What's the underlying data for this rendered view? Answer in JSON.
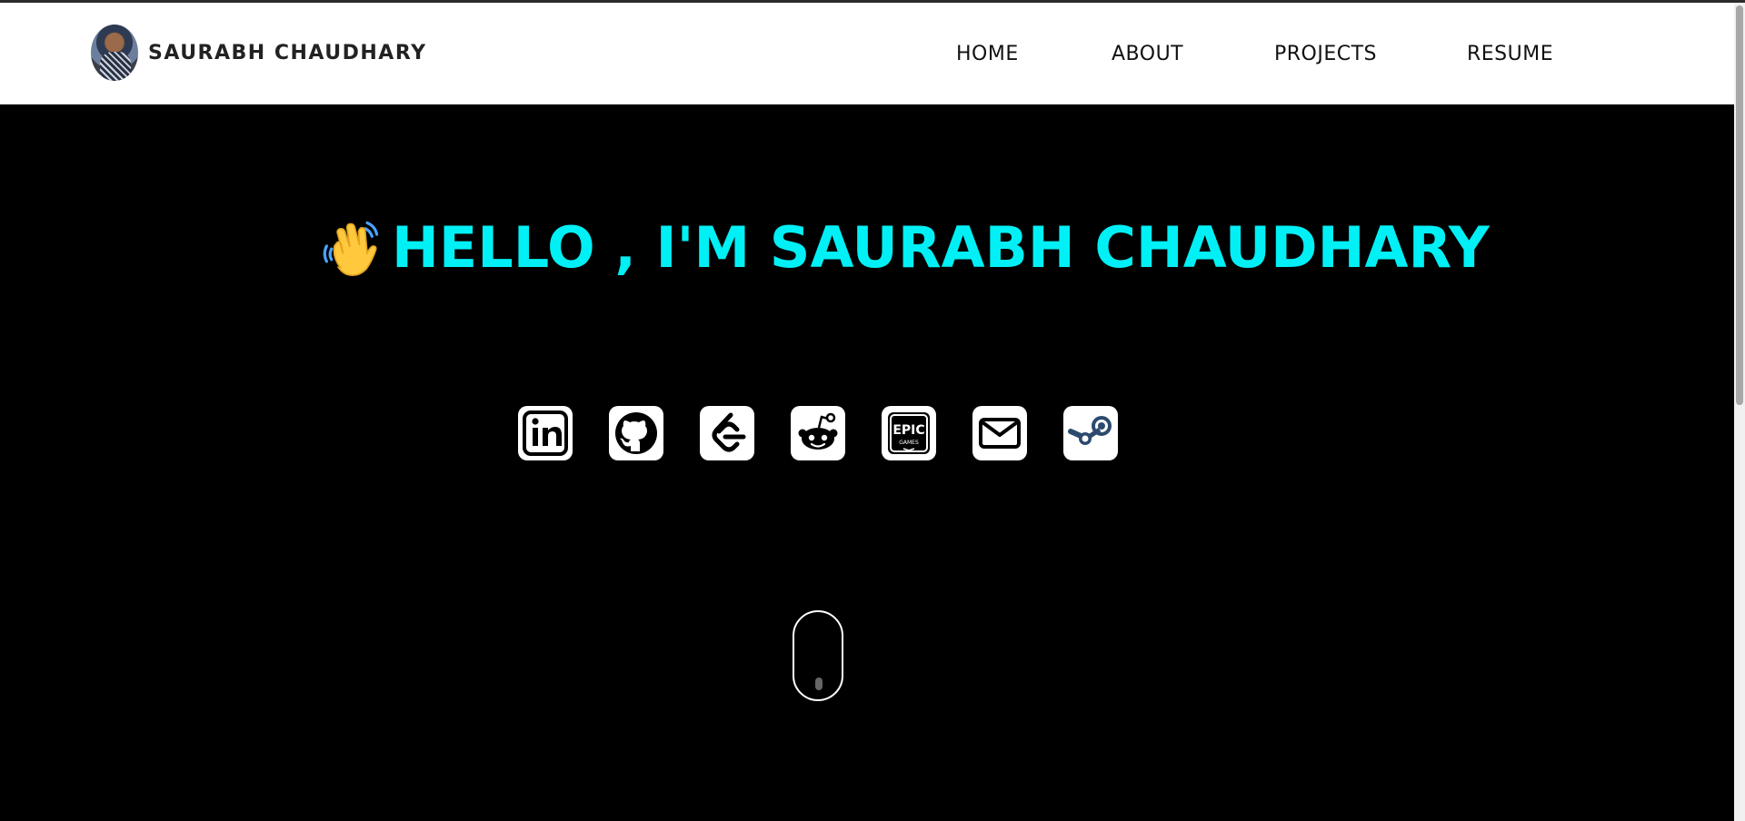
{
  "header": {
    "brand_name": "SAURABH CHAUDHARY",
    "nav": [
      {
        "label": "HOME"
      },
      {
        "label": "ABOUT"
      },
      {
        "label": "PROJECTS"
      },
      {
        "label": "RESUME"
      }
    ]
  },
  "hero": {
    "title": "HELLO , I'M SAURABH CHAUDHARY",
    "wave_icon": "waving-hand-icon",
    "title_color": "#00f0f5"
  },
  "socials": [
    {
      "name": "linkedin-icon"
    },
    {
      "name": "github-icon"
    },
    {
      "name": "leetcode-icon"
    },
    {
      "name": "reddit-icon"
    },
    {
      "name": "epic-games-icon",
      "text_line1": "EPIC",
      "text_line2": "GAMES"
    },
    {
      "name": "mail-icon"
    },
    {
      "name": "steam-icon"
    }
  ],
  "scroll_indicator": {
    "icon": "mouse-scroll-icon"
  },
  "colors": {
    "background": "#000000",
    "navbar": "#ffffff",
    "accent": "#00f0f5"
  }
}
